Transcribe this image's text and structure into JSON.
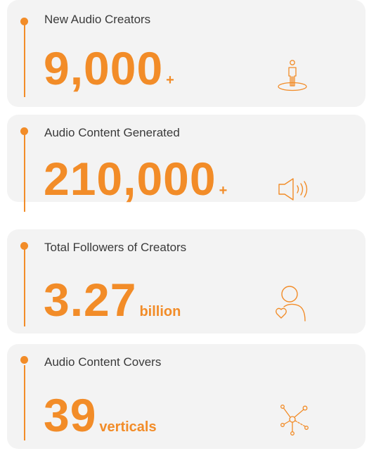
{
  "accent_color": "#f28c28",
  "cards": [
    {
      "label": "New Audio Creators",
      "number": "9,000",
      "suffix": "+",
      "icon": "person-on-platform-icon"
    },
    {
      "label": "Audio Content Generated",
      "number": "210,000",
      "suffix": "+",
      "icon": "speaker-icon"
    },
    {
      "label": "Total Followers of Creators",
      "number": "3.27",
      "suffix": "billion",
      "icon": "user-heart-icon"
    },
    {
      "label": "Audio Content Covers",
      "number": "39",
      "suffix": "verticals",
      "icon": "network-nodes-icon"
    }
  ]
}
